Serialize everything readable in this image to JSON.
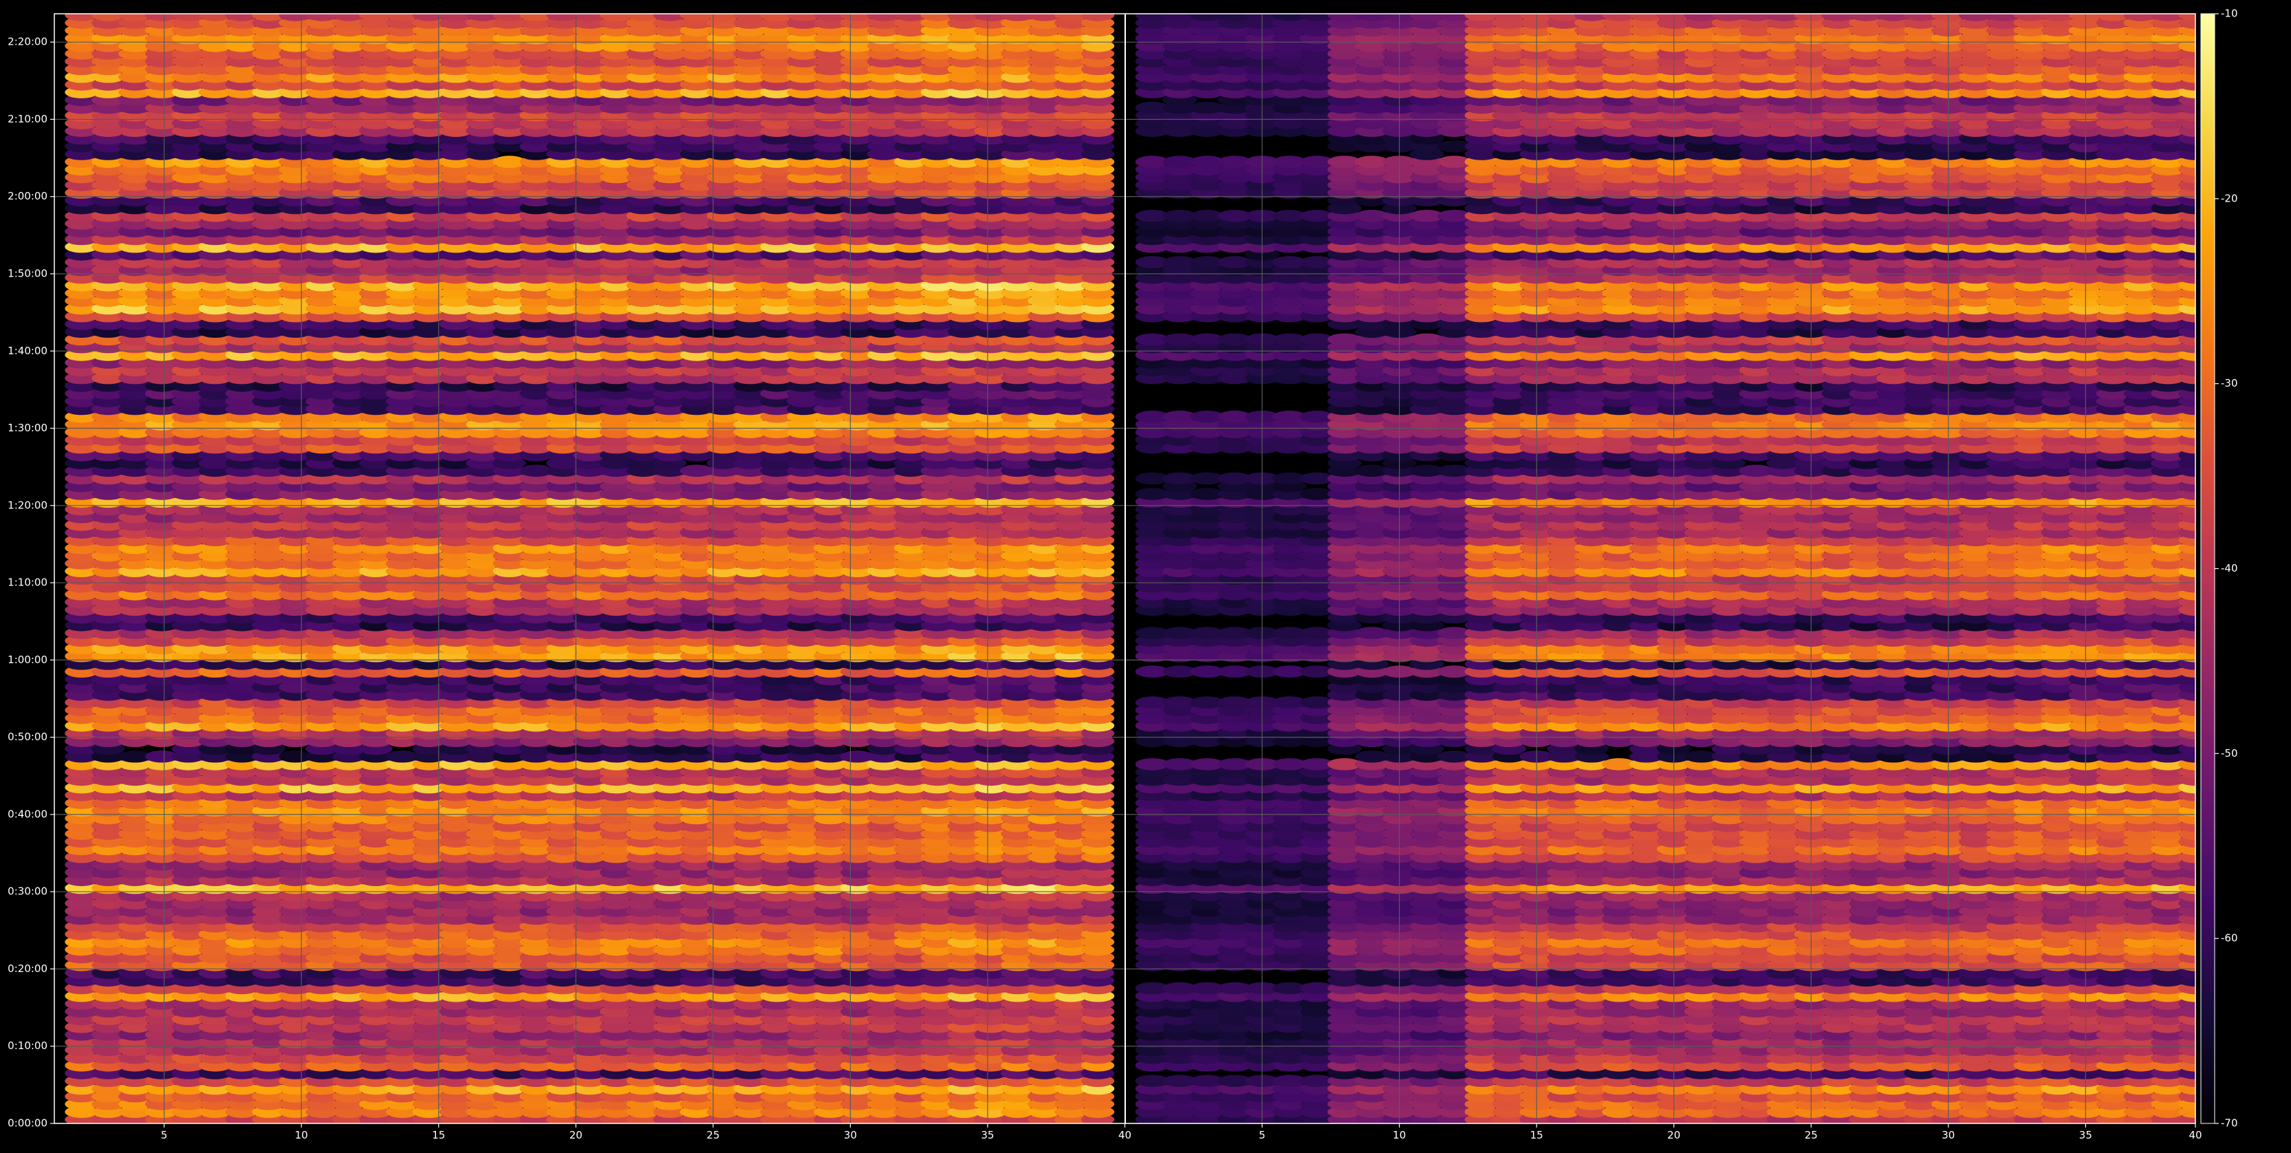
{
  "chart_data": {
    "type": "heatmap",
    "title": "",
    "xlabel": "",
    "ylabel": "",
    "colorbar_label": "",
    "colormap": "inferno",
    "grid": true,
    "colorbar": {
      "min": -70,
      "max": -10,
      "ticks": [
        -10,
        -20,
        -30,
        -40,
        -50,
        -60,
        -70
      ],
      "tick_labels": [
        "-10",
        "-20",
        "-30",
        "-40",
        "-50",
        "-60",
        "-70"
      ]
    },
    "x_axis": {
      "range": [
        1,
        79
      ],
      "ticks": [
        5,
        10,
        15,
        20,
        25,
        30,
        35,
        40,
        45,
        50,
        55,
        60,
        65,
        70,
        75,
        80
      ],
      "tick_labels": [
        "5",
        "10",
        "15",
        "20",
        "25",
        "30",
        "35",
        "40",
        "5",
        "10",
        "15",
        "20",
        "25",
        "30",
        "35",
        "40"
      ]
    },
    "y_axis": {
      "range_seconds": [
        0,
        8620
      ],
      "ticks_seconds": [
        0,
        600,
        1200,
        1800,
        2400,
        3000,
        3600,
        4200,
        4800,
        5400,
        6000,
        6600,
        7200,
        7800,
        8400
      ],
      "tick_labels": [
        "0:00:00",
        "0:10:00",
        "0:20:00",
        "0:30:00",
        "0:40:00",
        "0:50:00",
        "1:00:00",
        "1:10:00",
        "1:20:00",
        "1:30:00",
        "1:40:00",
        "1:50:00",
        "2:00:00",
        "2:10:00",
        "2:20:00"
      ]
    },
    "panels": [
      {
        "name": "",
        "x_range": [
          1.5,
          39.5
        ],
        "relative_level": "high"
      },
      {
        "name": "",
        "x_range": [
          40.5,
          79.5
        ],
        "relative_level": "lower for x 41-48, high for x 49-79"
      }
    ],
    "divider_x": 40,
    "rows": {
      "count": 145,
      "step_seconds": 60,
      "start_seconds": 0
    },
    "cells_per_panel": 39
  },
  "colors": {
    "background": "#000000",
    "grid": "#5a5a5a",
    "text": "#ffffff",
    "colormap_stops": [
      "#000004",
      "#160b39",
      "#420a68",
      "#6a176e",
      "#932667",
      "#bc3754",
      "#dd513a",
      "#f37819",
      "#fca50a",
      "#f6d746",
      "#fcffa4"
    ]
  }
}
